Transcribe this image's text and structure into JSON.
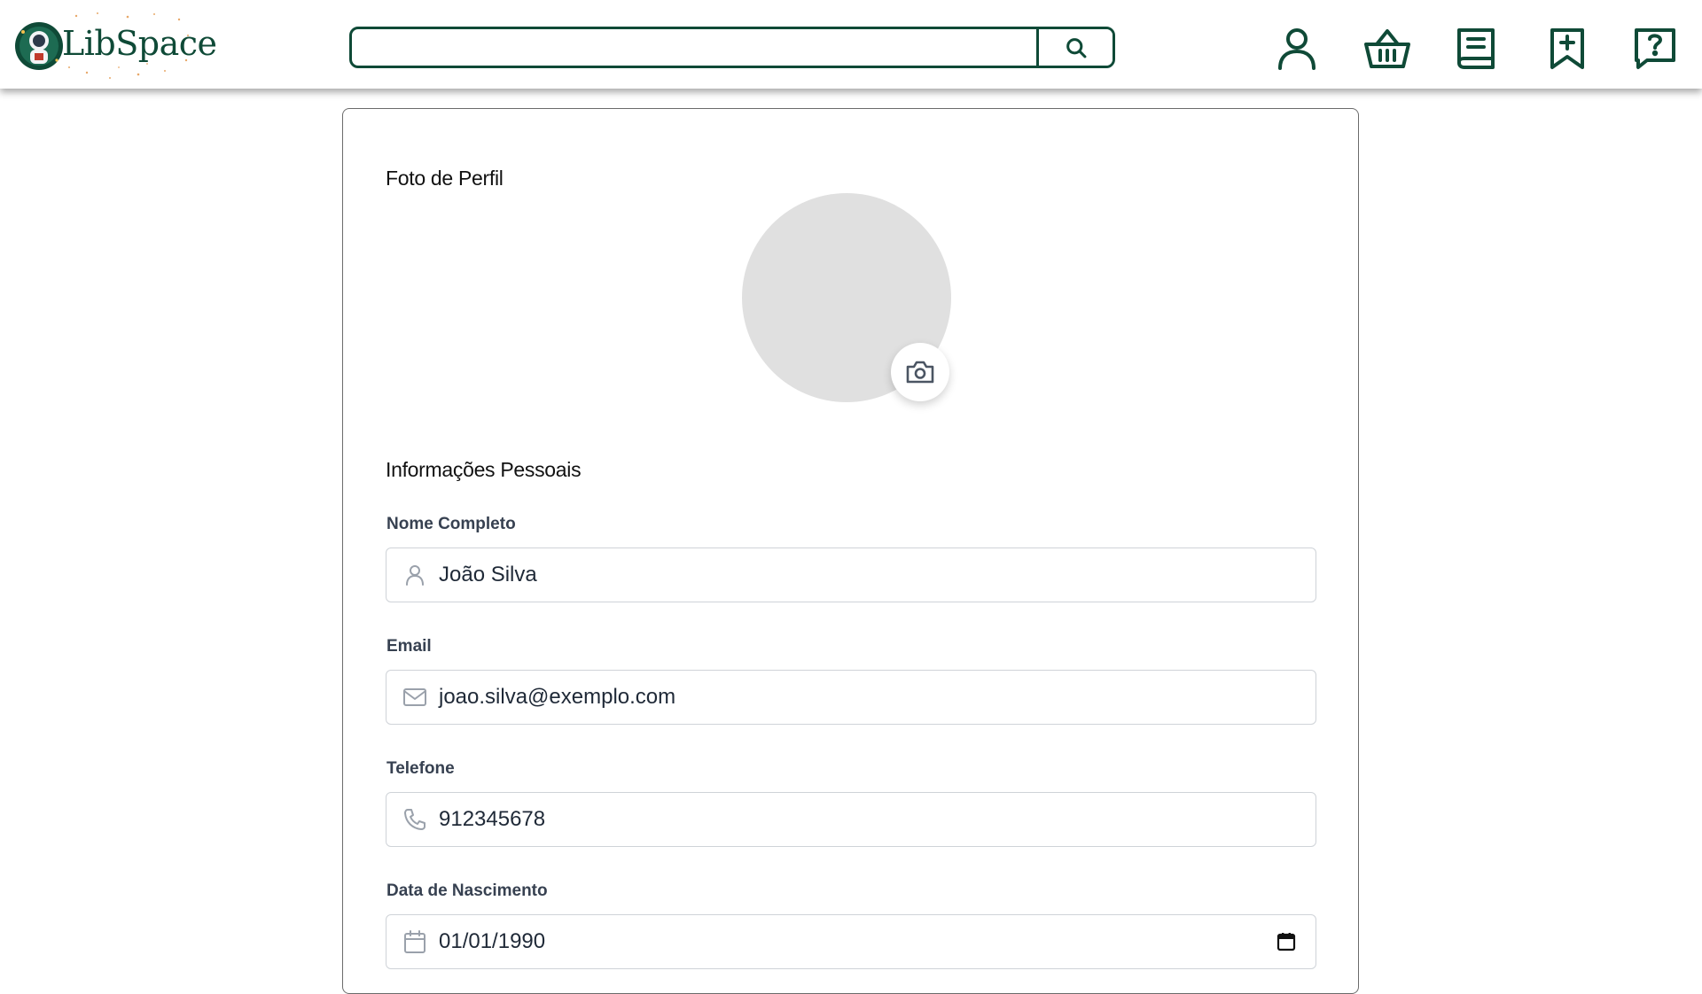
{
  "app": {
    "logo_text": "LibSpace",
    "brand_color": "#0f4a37"
  },
  "header": {
    "search": {
      "placeholder": "",
      "value": ""
    },
    "nav_icons": [
      "user-icon",
      "basket-icon",
      "book-icon",
      "bookmark-add-icon",
      "help-icon"
    ]
  },
  "profile": {
    "photo_title": "Foto de Perfil",
    "personal_title": "Informações Pessoais",
    "fields": {
      "name": {
        "label": "Nome Completo",
        "value": "João Silva",
        "icon": "user-icon"
      },
      "email": {
        "label": "Email",
        "value": "joao.silva@exemplo.com",
        "icon": "mail-icon"
      },
      "phone": {
        "label": "Telefone",
        "value": "912345678",
        "icon": "phone-icon"
      },
      "birthdate": {
        "label": "Data de Nascimento",
        "value": "01/01/1990",
        "icon": "calendar-icon"
      }
    }
  }
}
